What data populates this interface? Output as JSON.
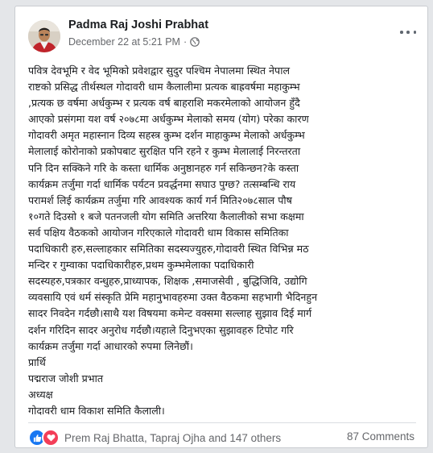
{
  "post": {
    "author": "Padma Raj Joshi Prabhat",
    "timestamp": "December 22 at 5:21 PM",
    "separator": "·",
    "privacy_icon": "globe-icon",
    "lines": [
      "पवित्र देवभूमि र वेद भूमिको प्रवेशद्वार सुदुर पश्चिम नेपालमा स्थित नेपाल",
      "राष्टको प्रसिद्ध तीर्थस्थल गोदावरी धाम कैलालीमा  प्रत्यक बाह्रवर्षमा महाकुम्भ",
      ",प्रत्यक छ वर्षमा अर्धकुम्भ र प्रत्यक वर्ष बाहराशि  मकरमेलाको आयोजन हुँदै",
      "आएको प्रसंगमा यश वर्ष २०७८मा अर्धकुम्भ मेलाको समय (योग) परेका कारण",
      "गोदावरी अमृत महास्नान दिव्य सहस्त्र कुम्भ दर्शन माहाकुम्भ मेलाको  अर्धकुम्भ",
      "मेलालाई  कोरोनाको प्रकोपबाट सुरक्षित पनि रहने र कुम्भ मेलालाई निरन्तरता",
      "पनि दिन सक्किने गरि के कस्ता धार्मिक  अनुष्ठानहरु गर्न सकिन्छन?के कस्ता",
      "कार्यक्रम तर्जुमा गर्दा  धार्मिक  पर्यटन प्रवर्द्धनमा सघाउ पुग्छ? तत्सम्बन्धि राय",
      "परामर्श लिई कार्यक्रम तर्जुमा गरि आवश्यक कार्य गर्न मिति२०७८साल पौष",
      "१०गते दिउसो १ बजे पतनजली योग समिति  अत्तरिया  कैलालीको सभा कक्षमा",
      "सर्व पक्षिय वैठकको आयोजन गरिएकाले गोदावरी धाम विकास समितिका",
      "पदाधिकारी हरु,सल्लाहकार समितिका सदस्यज्युहरु,गोदावरी स्थित विभिन्न मठ",
      "मन्दिर  र गुम्वाका पदाधिकारीहरु,प्रथम कुम्भमेलाका पदाधिकारी",
      "सदस्यहरु,पत्रकार वन्धुहरु,प्राध्यापक, शिक्षक ,समाजसेवी , बुद्धिजिवि, उद्योगि",
      "व्यवसायि एवं धर्म संस्कृति प्रेमि महानुभावहरुमा उक्त वैठकमा सहभागी भैदिनहुन",
      "सादर निवदेन गर्दछौ।साथै यश विषयमा कमेन्ट वक्समा सल्लाह सुझाव दिई मार्ग",
      "दर्शन गरिदिन सादर अनुरोध गर्दछौ।यहाले दिनुभएका सुझावहरु टिपोट गरि",
      "कार्यक्रम तर्जुमा गर्दा आधारको रुपमा लिनेछौं।",
      "   प्रार्थि",
      "   पद्मराज जोशी प्रभात",
      "अध्यक्ष",
      "गोदावरी धाम विकाश समिति कैलाली।"
    ]
  },
  "footer": {
    "reactions_text": "Prem Raj Bhatta, Tapraj Ojha and 147 others",
    "comments_text": "87 Comments"
  },
  "colors": {
    "like": "#1877f2",
    "love": "#f33e58",
    "secondary_text": "#65676b"
  }
}
